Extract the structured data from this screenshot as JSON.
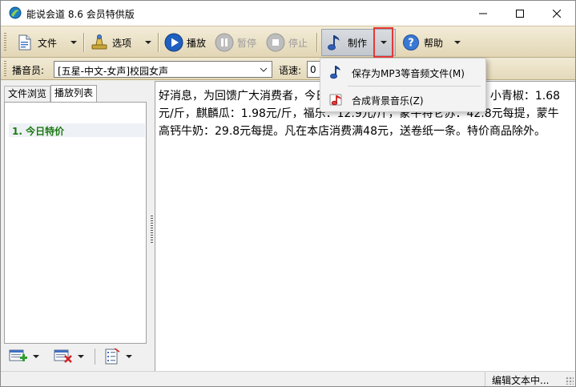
{
  "window": {
    "title": "能说会道 8.6 会员特供版"
  },
  "toolbar": {
    "file_label": "文件",
    "options_label": "选项",
    "play_label": "播放",
    "pause_label": "暂停",
    "stop_label": "停止",
    "make_label": "制作",
    "help_label": "帮助"
  },
  "voicebar": {
    "speaker_label": "播音员:",
    "speaker_value": "[五星-中文-女声]校园女声",
    "speed_label": "语速:",
    "speed_value": "0"
  },
  "leftpanel": {
    "tabs": [
      {
        "label": "文件浏览",
        "active": false
      },
      {
        "label": "播放列表",
        "active": true
      }
    ],
    "playlist": [
      {
        "label": "1. 今日特价",
        "selected": true
      }
    ]
  },
  "editor": {
    "text": "好消息，为回馈广大消费者，今日特价蔬菜：大白菜：0.48元/斤，小青椒：1.68元/斤，麒麟瓜：1.98元/斤，福乐：12.9元/斤，蒙牛特仑苏：42.8元每提，蒙牛高钙牛奶：29.8元每提。凡在本店消费满48元，送卷纸一条。特价商品除外。"
  },
  "menu": {
    "items": [
      {
        "label": "保存为MP3等音频文件(M)"
      },
      {
        "label": "合成背景音乐(Z)"
      }
    ]
  },
  "statusbar": {
    "text": "编辑文本中..."
  },
  "colors": {
    "highlight_box": "#e53935",
    "playlist_text": "#1b7a12",
    "toolbar_bg": "#e9dfc4"
  }
}
